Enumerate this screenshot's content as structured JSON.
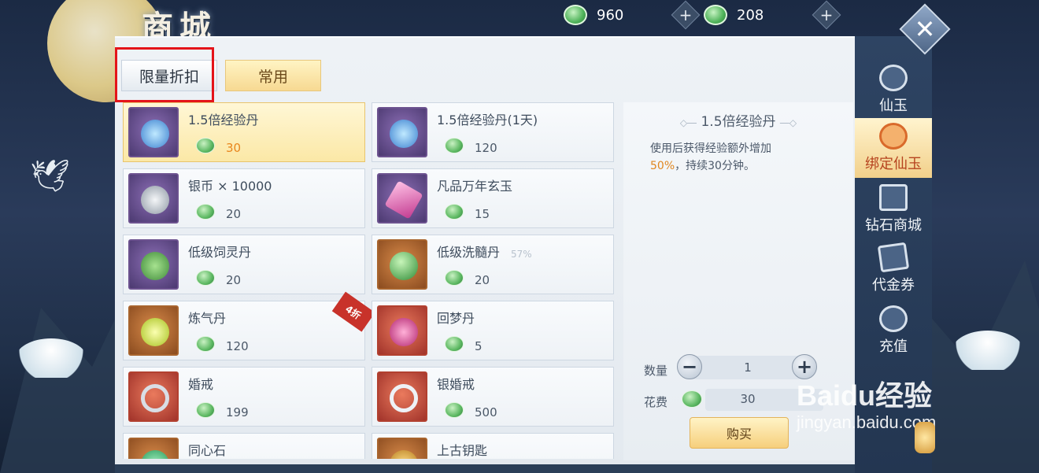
{
  "header": {
    "title": "商城",
    "currency_jade": "960",
    "currency_bound_jade": "208",
    "plus_symbol": "+",
    "close_symbol": "✕"
  },
  "tabs": [
    {
      "label": "限量折扣",
      "active": true
    },
    {
      "label": "常用",
      "active": false
    }
  ],
  "items": [
    {
      "name": "1.5倍经验丹",
      "price": "30",
      "icon": "purple-orb-icon"
    },
    {
      "name": "1.5倍经验丹(1天)",
      "price": "120",
      "icon": "purple-orb-icon"
    },
    {
      "name": "银币 × 10000",
      "price": "20",
      "icon": "silver-coin-icon"
    },
    {
      "name": "凡品万年玄玉",
      "price": "15",
      "icon": "crystal-icon"
    },
    {
      "name": "低级饲灵丹",
      "price": "20",
      "icon": "pill-tray-icon"
    },
    {
      "name": "低级洗髓丹",
      "price": "20",
      "icon": "green-pearl-icon"
    },
    {
      "name": "炼气丹",
      "price": "120",
      "icon": "qi-pill-icon",
      "badge": "4折"
    },
    {
      "name": "回梦丹",
      "price": "5",
      "icon": "dream-box-icon"
    },
    {
      "name": "婚戒",
      "price": "199",
      "icon": "ring-icon"
    },
    {
      "name": "银婚戒",
      "price": "500",
      "icon": "silver-ring-icon"
    },
    {
      "name": "同心石",
      "price": "",
      "icon": "jade-stone-icon"
    },
    {
      "name": "上古钥匙",
      "price": "",
      "icon": "ancient-key-icon"
    }
  ],
  "ghost_text": "57%",
  "detail": {
    "title": "1.5倍经验丹",
    "desc_before": "使用后获得经验额外增加",
    "desc_highlight": "50%",
    "desc_after": "，持续30分钟。",
    "qty_label": "数量",
    "qty_value": "1",
    "minus_symbol": "−",
    "plus_symbol": "+",
    "cost_label": "花费",
    "cost_value": "30",
    "buy_label": "购买"
  },
  "nav": [
    {
      "label": "仙玉",
      "icon": "jade-icon",
      "active": false
    },
    {
      "label": "绑定仙玉",
      "icon": "bound-jade-icon",
      "active": true
    },
    {
      "label": "钻石商城",
      "icon": "diamond-shop-icon",
      "active": false
    },
    {
      "label": "代金券",
      "icon": "voucher-icon",
      "active": false
    },
    {
      "label": "充值",
      "icon": "recharge-icon",
      "active": false
    }
  ],
  "watermark": {
    "main": "Baidu经验",
    "sub": "jingyan.baidu.com"
  }
}
